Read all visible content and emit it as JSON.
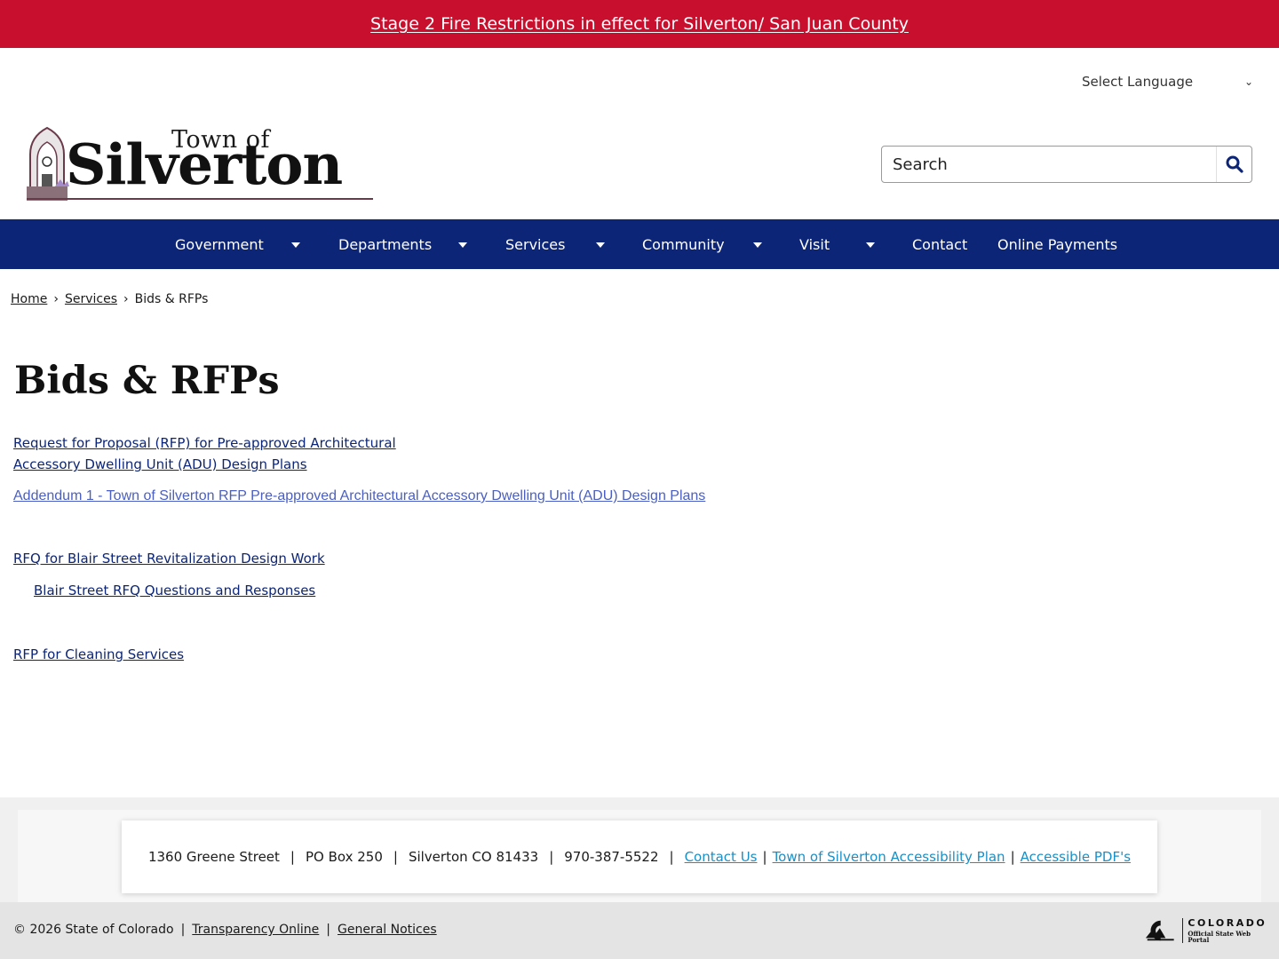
{
  "alert": {
    "text": "Stage 2 Fire Restrictions in effect for Silverton/ San Juan County"
  },
  "language": {
    "label": "Select Language"
  },
  "logo": {
    "town_of": "Town of",
    "name": "Silverton"
  },
  "search": {
    "placeholder": "Search"
  },
  "nav": {
    "items": [
      {
        "label": "Government",
        "has_dropdown": true
      },
      {
        "label": "Departments",
        "has_dropdown": true
      },
      {
        "label": "Services",
        "has_dropdown": true
      },
      {
        "label": "Community",
        "has_dropdown": true
      },
      {
        "label": "Visit",
        "has_dropdown": true
      },
      {
        "label": "Contact",
        "has_dropdown": false
      },
      {
        "label": "Online Payments",
        "has_dropdown": false
      }
    ]
  },
  "breadcrumb": {
    "home": "Home",
    "services": "Services",
    "current": "Bids & RFPs",
    "separator": "›"
  },
  "page": {
    "title": "Bids & RFPs",
    "links": {
      "adu_rfp_line1": "Request for Proposal (RFP) for Pre-approved Architectural",
      "adu_rfp_line2": "Accessory Dwelling Unit (ADU) Design Plans",
      "addendum": "Addendum 1 - Town of Silverton RFP Pre-approved Architectural Accessory Dwelling Unit (ADU) Design Plans",
      "blair_rfq": "RFQ for Blair Street Revitalization Design Work",
      "blair_qa": "Blair Street RFQ Questions and Responses",
      "cleaning": "RFP for Cleaning Services"
    }
  },
  "footer": {
    "address": "1360 Greene Street",
    "po_box": "PO Box 250",
    "city": "Silverton CO 81433",
    "phone": "970-387-5522",
    "contact_us": "Contact Us",
    "accessibility_plan": "Town of Silverton Accessibility Plan",
    "accessible_pdfs": "Accessible PDF's",
    "separator": "|"
  },
  "bottom": {
    "copyright": "© 2026 State of Colorado",
    "transparency": "Transparency Online",
    "notices": "General Notices",
    "separator": "|",
    "colorado_name": "COLORADO",
    "colorado_sub": "Official State Web Portal"
  },
  "colors": {
    "alert_bg": "#c8102e",
    "nav_bg": "#0c2576",
    "link": "#0c2576",
    "footer_link": "#1a8fc6"
  }
}
